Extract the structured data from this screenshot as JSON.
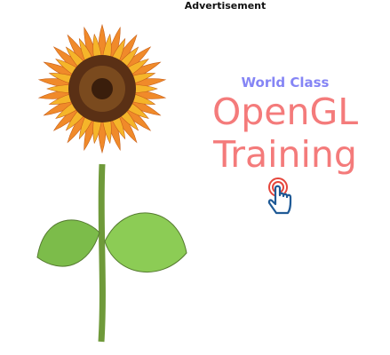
{
  "ad_label": "Advertisement",
  "ad": {
    "subtitle": "World Class",
    "title_line1": "OpenGL",
    "title_line2": "Training",
    "colors": {
      "title": "#f47b7b",
      "subtitle": "#8585f5",
      "hand": "#1f5a96",
      "ripple": "#e5463c"
    },
    "image": "sunflower-illustration",
    "cta_icon": "tap-hand-icon"
  }
}
